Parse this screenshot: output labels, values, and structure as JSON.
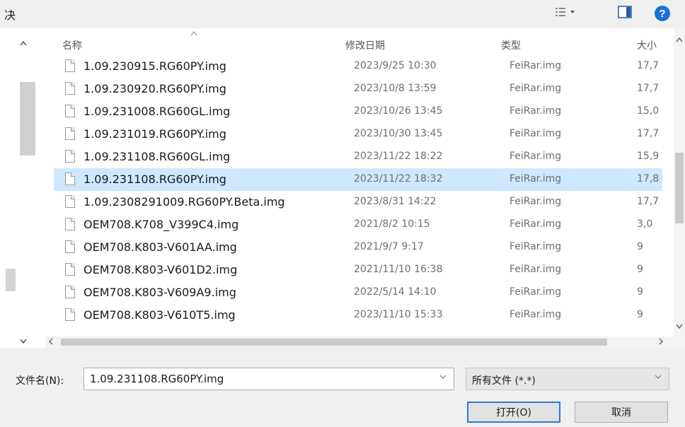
{
  "window": {
    "title_fragment": "决"
  },
  "toolbar": {
    "view_icon": "list-view-icon",
    "pane_icon": "preview-pane-icon",
    "help_icon": "help-icon",
    "help_label": "?"
  },
  "columns": {
    "name": "名称",
    "date": "修改日期",
    "type": "类型",
    "size": "大小"
  },
  "files": [
    {
      "name": "1.09.230915.RG60PY.img",
      "date": "2023/9/25 10:30",
      "type": "FeiRar.img",
      "size": "17,7"
    },
    {
      "name": "1.09.230920.RG60PY.img",
      "date": "2023/10/8 13:59",
      "type": "FeiRar.img",
      "size": "17,7"
    },
    {
      "name": "1.09.231008.RG60GL.img",
      "date": "2023/10/26 13:45",
      "type": "FeiRar.img",
      "size": "15,0"
    },
    {
      "name": "1.09.231019.RG60PY.img",
      "date": "2023/10/30 13:45",
      "type": "FeiRar.img",
      "size": "17,7"
    },
    {
      "name": "1.09.231108.RG60GL.img",
      "date": "2023/11/22 18:22",
      "type": "FeiRar.img",
      "size": "15,9"
    },
    {
      "name": "1.09.231108.RG60PY.img",
      "date": "2023/11/22 18:32",
      "type": "FeiRar.img",
      "size": "17,8"
    },
    {
      "name": "1.09.2308291009.RG60PY.Beta.img",
      "date": "2023/8/31 14:22",
      "type": "FeiRar.img",
      "size": "17,7"
    },
    {
      "name": "OEM708.K708_V399C4.img",
      "date": "2021/8/2 10:15",
      "type": "FeiRar.img",
      "size": "3,0"
    },
    {
      "name": "OEM708.K803-V601AA.img",
      "date": "2021/9/7 9:17",
      "type": "FeiRar.img",
      "size": "9"
    },
    {
      "name": "OEM708.K803-V601D2.img",
      "date": "2021/11/10 16:38",
      "type": "FeiRar.img",
      "size": "9"
    },
    {
      "name": "OEM708.K803-V609A9.img",
      "date": "2022/5/14 14:10",
      "type": "FeiRar.img",
      "size": "9"
    },
    {
      "name": "OEM708.K803-V610T5.img",
      "date": "2023/11/10 15:33",
      "type": "FeiRar.img",
      "size": "9"
    }
  ],
  "selected_file": "1.09.231108.RG60PY.img",
  "filename_field": {
    "label": "文件名(N):",
    "value": "1.09.231108.RG60PY.img"
  },
  "filter": {
    "value": "所有文件 (*.*)"
  },
  "buttons": {
    "open": "打开(O)",
    "cancel": "取消"
  },
  "colors": {
    "selection": "#cde8ff",
    "accent": "#2a7ad6"
  }
}
